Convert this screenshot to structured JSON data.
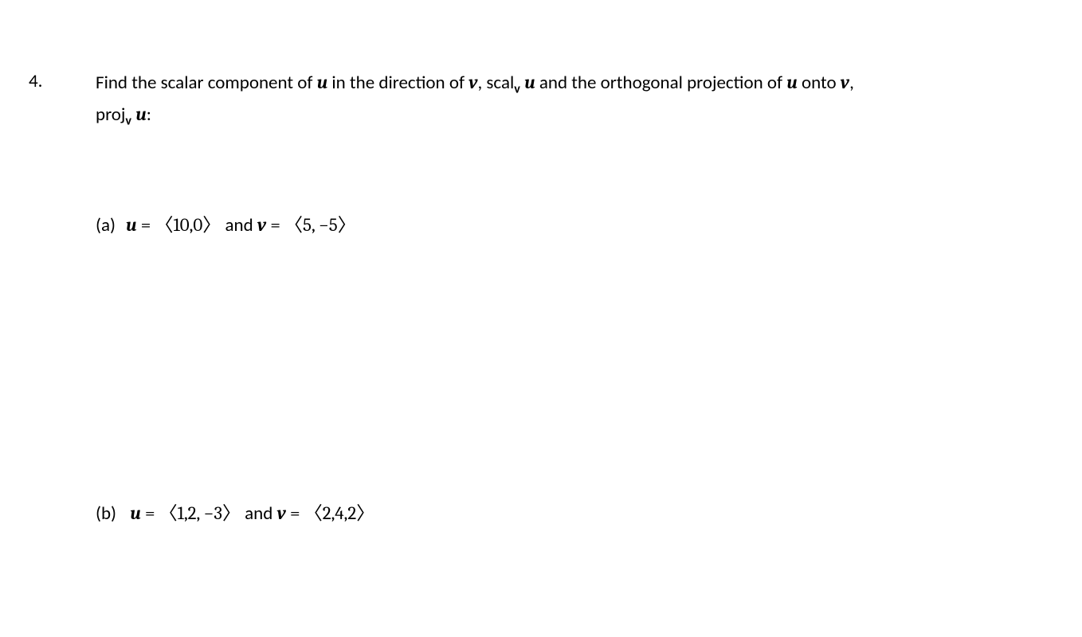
{
  "problem": {
    "number": "4.",
    "statement_part1": "Find the scalar component of ",
    "u1": "u",
    "statement_part2": " in the direction of ",
    "v1": "v",
    "statement_part3": ", scal",
    "sub_v1": "v",
    "space1": " ",
    "u2": "u",
    "statement_part4": " and the orthogonal projection of ",
    "u3": "u",
    "statement_part5": " onto ",
    "v2": "v",
    "statement_part6": ", proj",
    "sub_v2": "v",
    "space2": " ",
    "u4": "u",
    "statement_part7": ":"
  },
  "parts": {
    "a": {
      "label": "(a)",
      "u_sym": "u",
      "eq1": " = ",
      "u_val": "〈10,0〉",
      "and_text": " and ",
      "v_sym": "v",
      "eq2": " = ",
      "v_val": "〈5, −5〉"
    },
    "b": {
      "label": "(b)",
      "u_sym": "u",
      "eq1": " = ",
      "u_val": "〈1,2, −3〉",
      "and_text": " and ",
      "v_sym": "v",
      "eq2": " = ",
      "v_val": "〈2,4,2〉"
    }
  }
}
